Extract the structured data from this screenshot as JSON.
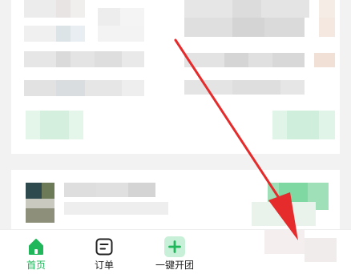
{
  "tabbar": {
    "tabs": [
      {
        "label": "首页",
        "icon": "home-icon",
        "active": true
      },
      {
        "label": "订单",
        "icon": "order-icon",
        "active": false
      },
      {
        "label": "一键开团",
        "icon": "plus-icon",
        "active": false
      }
    ]
  },
  "colors": {
    "accent": "#1fb75a",
    "arrow": "#e52b2b",
    "plus_bg": "#c8f0d8"
  }
}
